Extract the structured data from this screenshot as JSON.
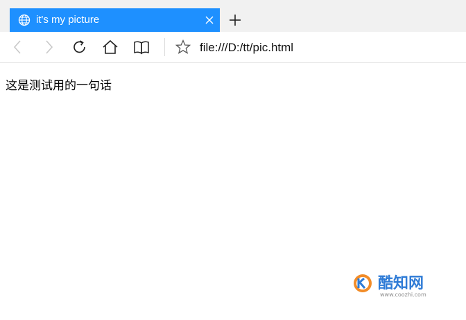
{
  "tab": {
    "title": "it's my picture",
    "icon": "globe-icon"
  },
  "toolbar": {
    "back_icon": "back-arrow-icon",
    "forward_icon": "forward-arrow-icon",
    "refresh_icon": "refresh-icon",
    "home_icon": "home-icon",
    "reading_view_icon": "book-icon",
    "favorite_icon": "star-icon",
    "address": "file:///D:/tt/pic.html"
  },
  "page": {
    "text": "这是测试用的一句话"
  },
  "watermark": {
    "brand_text": "酷知网",
    "url_text": "www.coozhi.com"
  },
  "colors": {
    "tab_active": "#1e90ff",
    "tabstrip_bg": "#f1f1f1",
    "watermark_blue": "#2e7bd6",
    "watermark_orange": "#f28c28"
  }
}
